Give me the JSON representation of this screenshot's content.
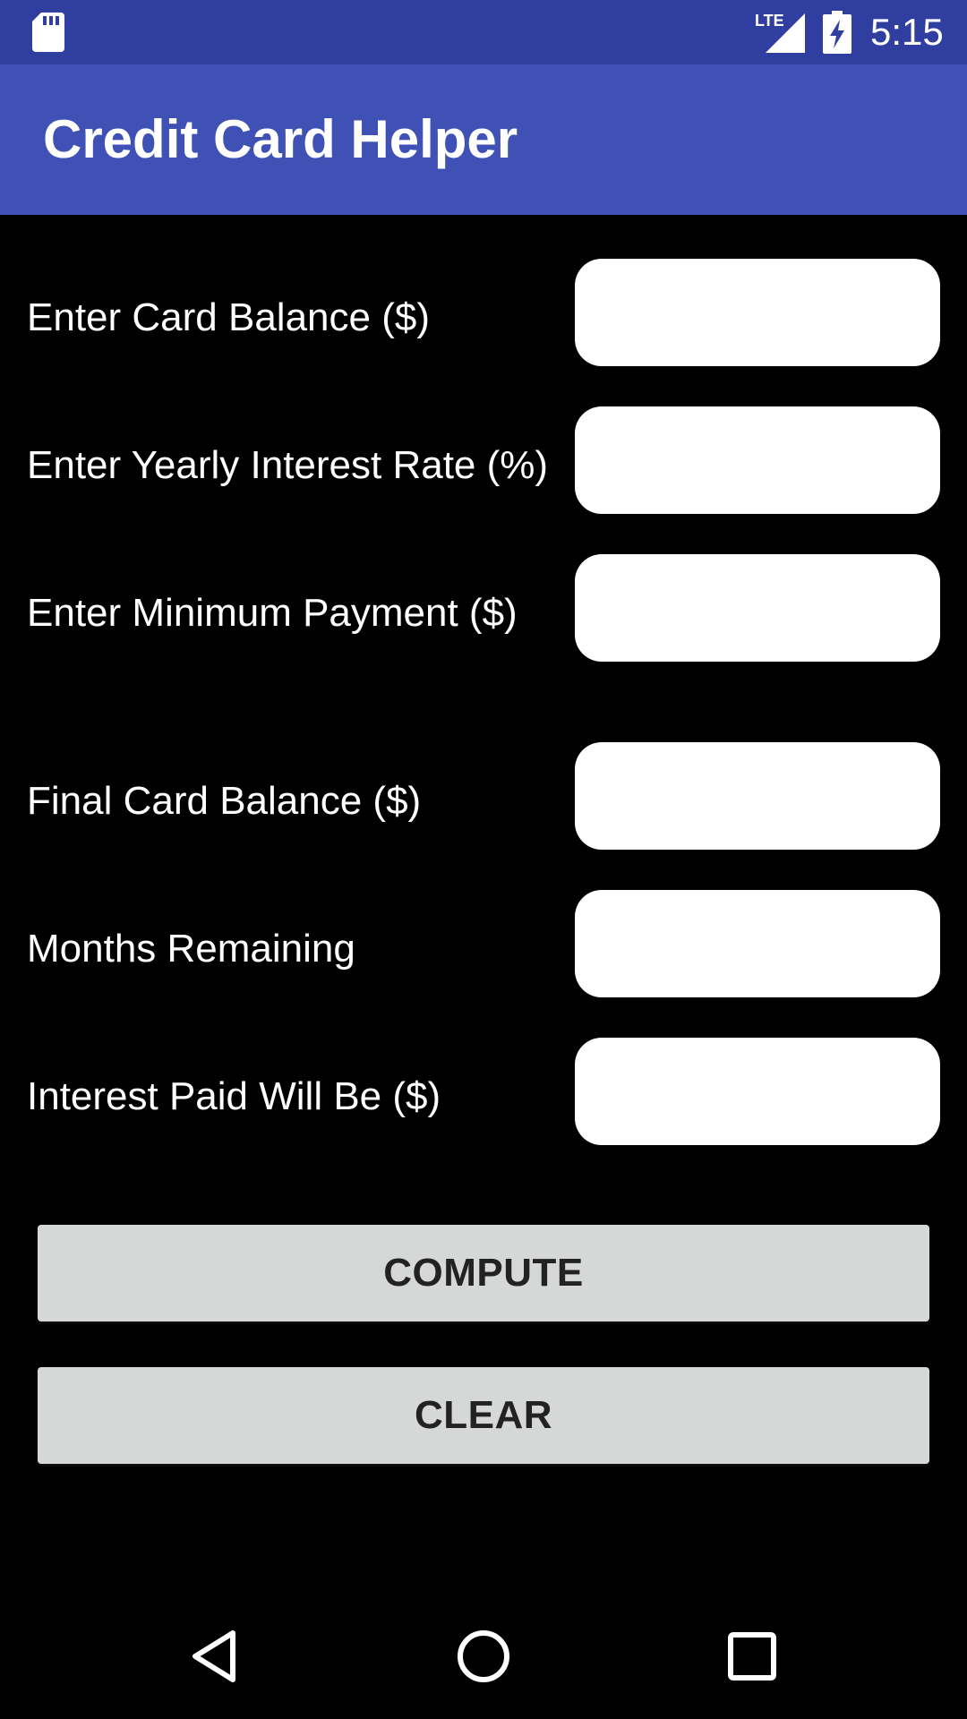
{
  "status_bar": {
    "time": "5:15",
    "network": "LTE",
    "icons": [
      "sd-card-icon",
      "signal-icon",
      "battery-charging-icon"
    ]
  },
  "app_bar": {
    "title": "Credit Card Helper",
    "color": "#3F51B5"
  },
  "form": {
    "rows": [
      {
        "label": "Enter Card Balance ($)",
        "value": ""
      },
      {
        "label": "Enter Yearly Interest Rate (%)",
        "value": ""
      },
      {
        "label": "Enter Minimum Payment ($)",
        "value": ""
      },
      {
        "label": "Final Card Balance ($)",
        "value": ""
      },
      {
        "label": "Months Remaining",
        "value": ""
      },
      {
        "label": "Interest Paid Will Be ($)",
        "value": ""
      }
    ]
  },
  "buttons": {
    "compute": "COMPUTE",
    "clear": "CLEAR"
  },
  "nav_bar": {
    "icons": [
      "back-icon",
      "home-icon",
      "recents-icon"
    ]
  },
  "colors": {
    "status_bar": "#303F9F",
    "app_bar": "#3F51B5",
    "background": "#000000",
    "button": "#D6D7D7"
  }
}
